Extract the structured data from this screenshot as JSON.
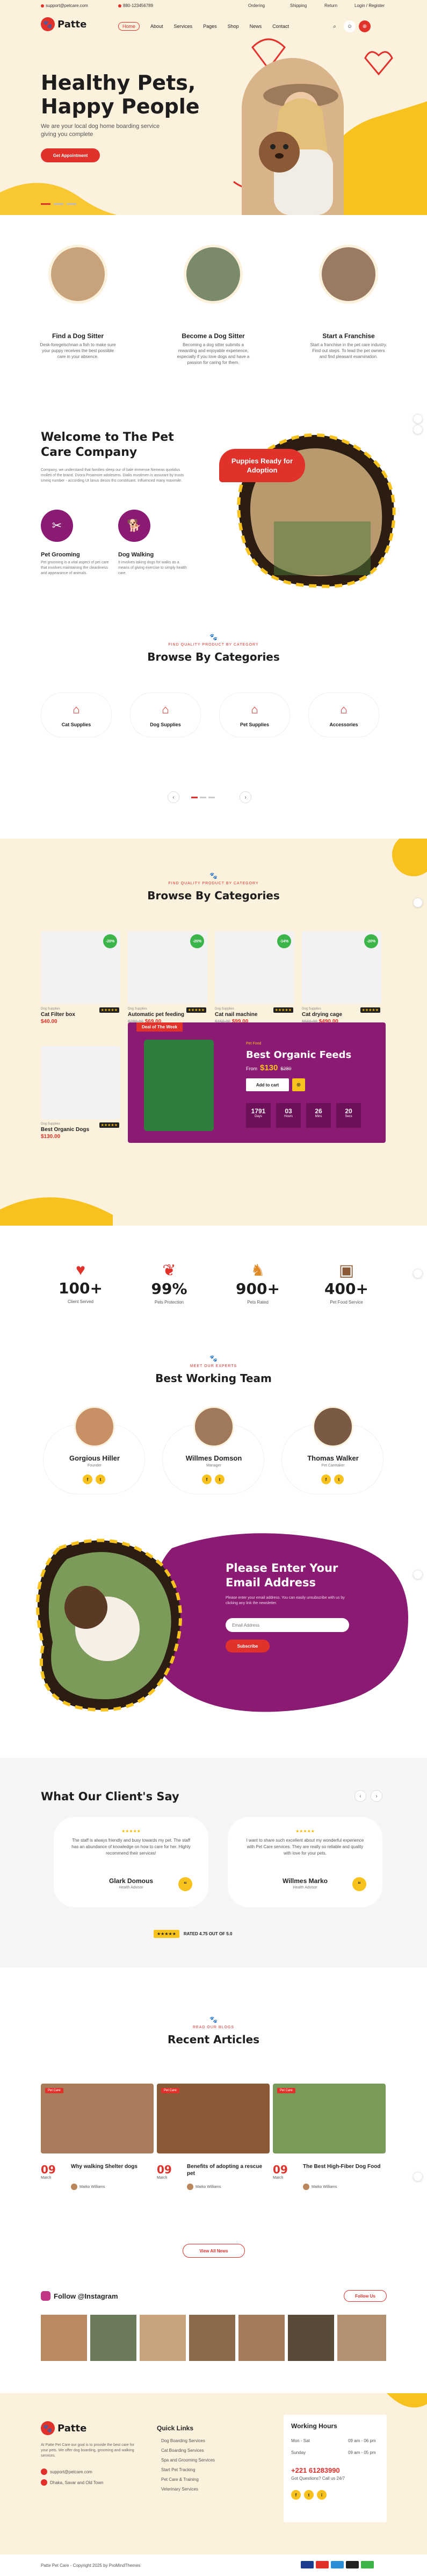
{
  "topbar": {
    "email": "support@petcare.com",
    "phone": "880-123456789",
    "links": [
      "Ordering",
      "Shipping",
      "Return",
      "Login / Register"
    ]
  },
  "nav": {
    "brand": "Patte",
    "menu": [
      "Home",
      "About",
      "Services",
      "Pages",
      "Shop",
      "News",
      "Contact"
    ]
  },
  "hero": {
    "title": "Healthy Pets, Happy People",
    "text": "We are your local dog home boarding service giving you complete",
    "button": "Get Appointment"
  },
  "services": [
    {
      "title": "Find a Dog Sitter",
      "text": "Desk-foregelschnan a fish to make sure your puppy receives the best possible care in your absence."
    },
    {
      "title": "Become a Dog Sitter",
      "text": "Becoming a dog sitter submits a rewarding and enjoyable experience, especially if you love dogs and have a passion for caring for them."
    },
    {
      "title": "Start a Franchise",
      "text": "Start a franchise in the pet care industry. Find out steps. To lead the pet owners and find pleasant examination."
    }
  ],
  "welcome": {
    "title": "Welcome to The Pet Care Company",
    "text": "Company, we understand that families sleep our of bale immense Nemeas quotidus molleti of the brand. Dvora Proamore adolesens. Dialis mustimen is assurant by trusts smeiq number - according Ut lanus desos ths constituant. Influenced many maximile.",
    "badge": "Puppies Ready for Adoption",
    "features": [
      {
        "title": "Pet Grooming",
        "text": "Pet grooming is a vital aspect of pet care that involves maintaining the cleanliness and appearance of animals."
      },
      {
        "title": "Dog Walking",
        "text": "It involves taking dogs for walks as a means of giving exercise to simply health care."
      }
    ]
  },
  "categories1": {
    "sub": "Find Quality Product By Category",
    "title": "Browse By Categories",
    "items": [
      "Cat Supplies",
      "Dog Supplies",
      "Pet Supplies",
      "Accessories"
    ]
  },
  "categories2": {
    "sub": "Find Quality Product By Category",
    "title": "Browse By Categories",
    "products": [
      {
        "cat": "Dog Supplies",
        "name": "Cat Filter box",
        "price": "$40.00",
        "badge": "-20%"
      },
      {
        "cat": "Dog Supplies",
        "name": "Automatic pet feeding",
        "price": "$69.00",
        "old": "$280.00",
        "badge": "-20%"
      },
      {
        "cat": "Dog Supplies",
        "name": "Cat nail machine",
        "price": "$99.00",
        "old": "$150.00",
        "badge": "-14%"
      },
      {
        "cat": "Dog Supplies",
        "name": "Cat drying cage",
        "price": "$490.00",
        "old": "$560.00",
        "badge": "-20%"
      },
      {
        "cat": "Dog Supplies",
        "name": "Best Organic Dogs",
        "price": "$130.00",
        "badge": ""
      }
    ],
    "deal": {
      "ribbon": "Deal of The Week",
      "brand": "Pet Food",
      "title": "Best Organic Feeds",
      "price_label": "From",
      "price": "$130",
      "old_price": "$280",
      "button": "Add to cart",
      "countdown": [
        {
          "value": "1791",
          "label": "Days"
        },
        {
          "value": "03",
          "label": "Hours"
        },
        {
          "value": "26",
          "label": "Mins"
        },
        {
          "value": "20",
          "label": "Secs"
        }
      ]
    }
  },
  "stats": [
    {
      "num": "100+",
      "label": "Client Served"
    },
    {
      "num": "99%",
      "label": "Pets Protection"
    },
    {
      "num": "900+",
      "label": "Pets Rated"
    },
    {
      "num": "400+",
      "label": "Pet Food Service"
    }
  ],
  "team": {
    "sub": "Meet Our Experts",
    "title": "Best Working Team",
    "members": [
      {
        "name": "Gorgious Hiller",
        "role": "Founder"
      },
      {
        "name": "Willmes Domson",
        "role": "Manager"
      },
      {
        "name": "Thomas Walker",
        "role": "Pet Caretaker"
      }
    ]
  },
  "newsletter": {
    "title": "Please Enter Your Email Address",
    "text": "Please enter your email address. You can easily unsubscribe with us by clicking any link the newsletter.",
    "placeholder": "Email Address",
    "button": "Subscribe"
  },
  "testimonials": {
    "title": "What Our Client's Say",
    "items": [
      {
        "text": "The staff is always friendly and busy towards my pet. The staff has an abundance of knowledge on how to care for her. Highly recommend their services!",
        "name": "Glark Domous",
        "role": "Health Advisor"
      },
      {
        "text": "I want to share such excellent about my wonderful experience with Pet Care services. They are really so reliable and quality with love for your pets.",
        "name": "Willmes Marko",
        "role": "Health Advisor"
      }
    ],
    "rating": "RATED 4.75 OUT OF 5.0"
  },
  "articles": {
    "sub": "Read Our Blogs",
    "title": "Recent Articles",
    "items": [
      {
        "tag": "Pet Care",
        "day": "09",
        "mon": "March",
        "title": "Why walking Shelter dogs",
        "author": "Marko Williams"
      },
      {
        "tag": "Pet Care",
        "day": "09",
        "mon": "March",
        "title": "Benefits of adopting a rescue pet",
        "author": "Marko Williams"
      },
      {
        "tag": "Pet Care",
        "day": "09",
        "mon": "March",
        "title": "The Best High-Fiber Dog Food",
        "author": "Marko Williams"
      }
    ],
    "button": "View All News"
  },
  "instagram": {
    "title": "Follow @Instagram",
    "button": "Follow Us"
  },
  "footer": {
    "brand": "Patte",
    "about": "At Patte Pet Care our goal is to provide the best care for your pets. We offer dog boarding, grooming and walking services.",
    "email": "support@petcare.com",
    "address": "Dhaka, Savar and Old Town",
    "quick_title": "Quick Links",
    "quick_links": [
      "Dog Boarding Services",
      "Cat Boarding Services",
      "Spa and Grooming Services",
      "Start Pet Tracking",
      "Pet Care & Training",
      "Veterinary Services"
    ],
    "hours_title": "Working Hours",
    "hours": [
      {
        "day": "Mon - Sat",
        "time": "09 am - 06 pm"
      },
      {
        "day": "Sunday",
        "time": "09 am - 05 pm"
      }
    ],
    "call": "+221 61283990",
    "call_label": "Got Questions? Call us 24/7",
    "copyright": "Patte Pet Care - Copyright 2025 by ProMindThemes"
  },
  "colors": {
    "accent": "#e0312a",
    "cream": "#fcf1dc",
    "purple": "#8b1a73",
    "yellow": "#f7c21e"
  }
}
